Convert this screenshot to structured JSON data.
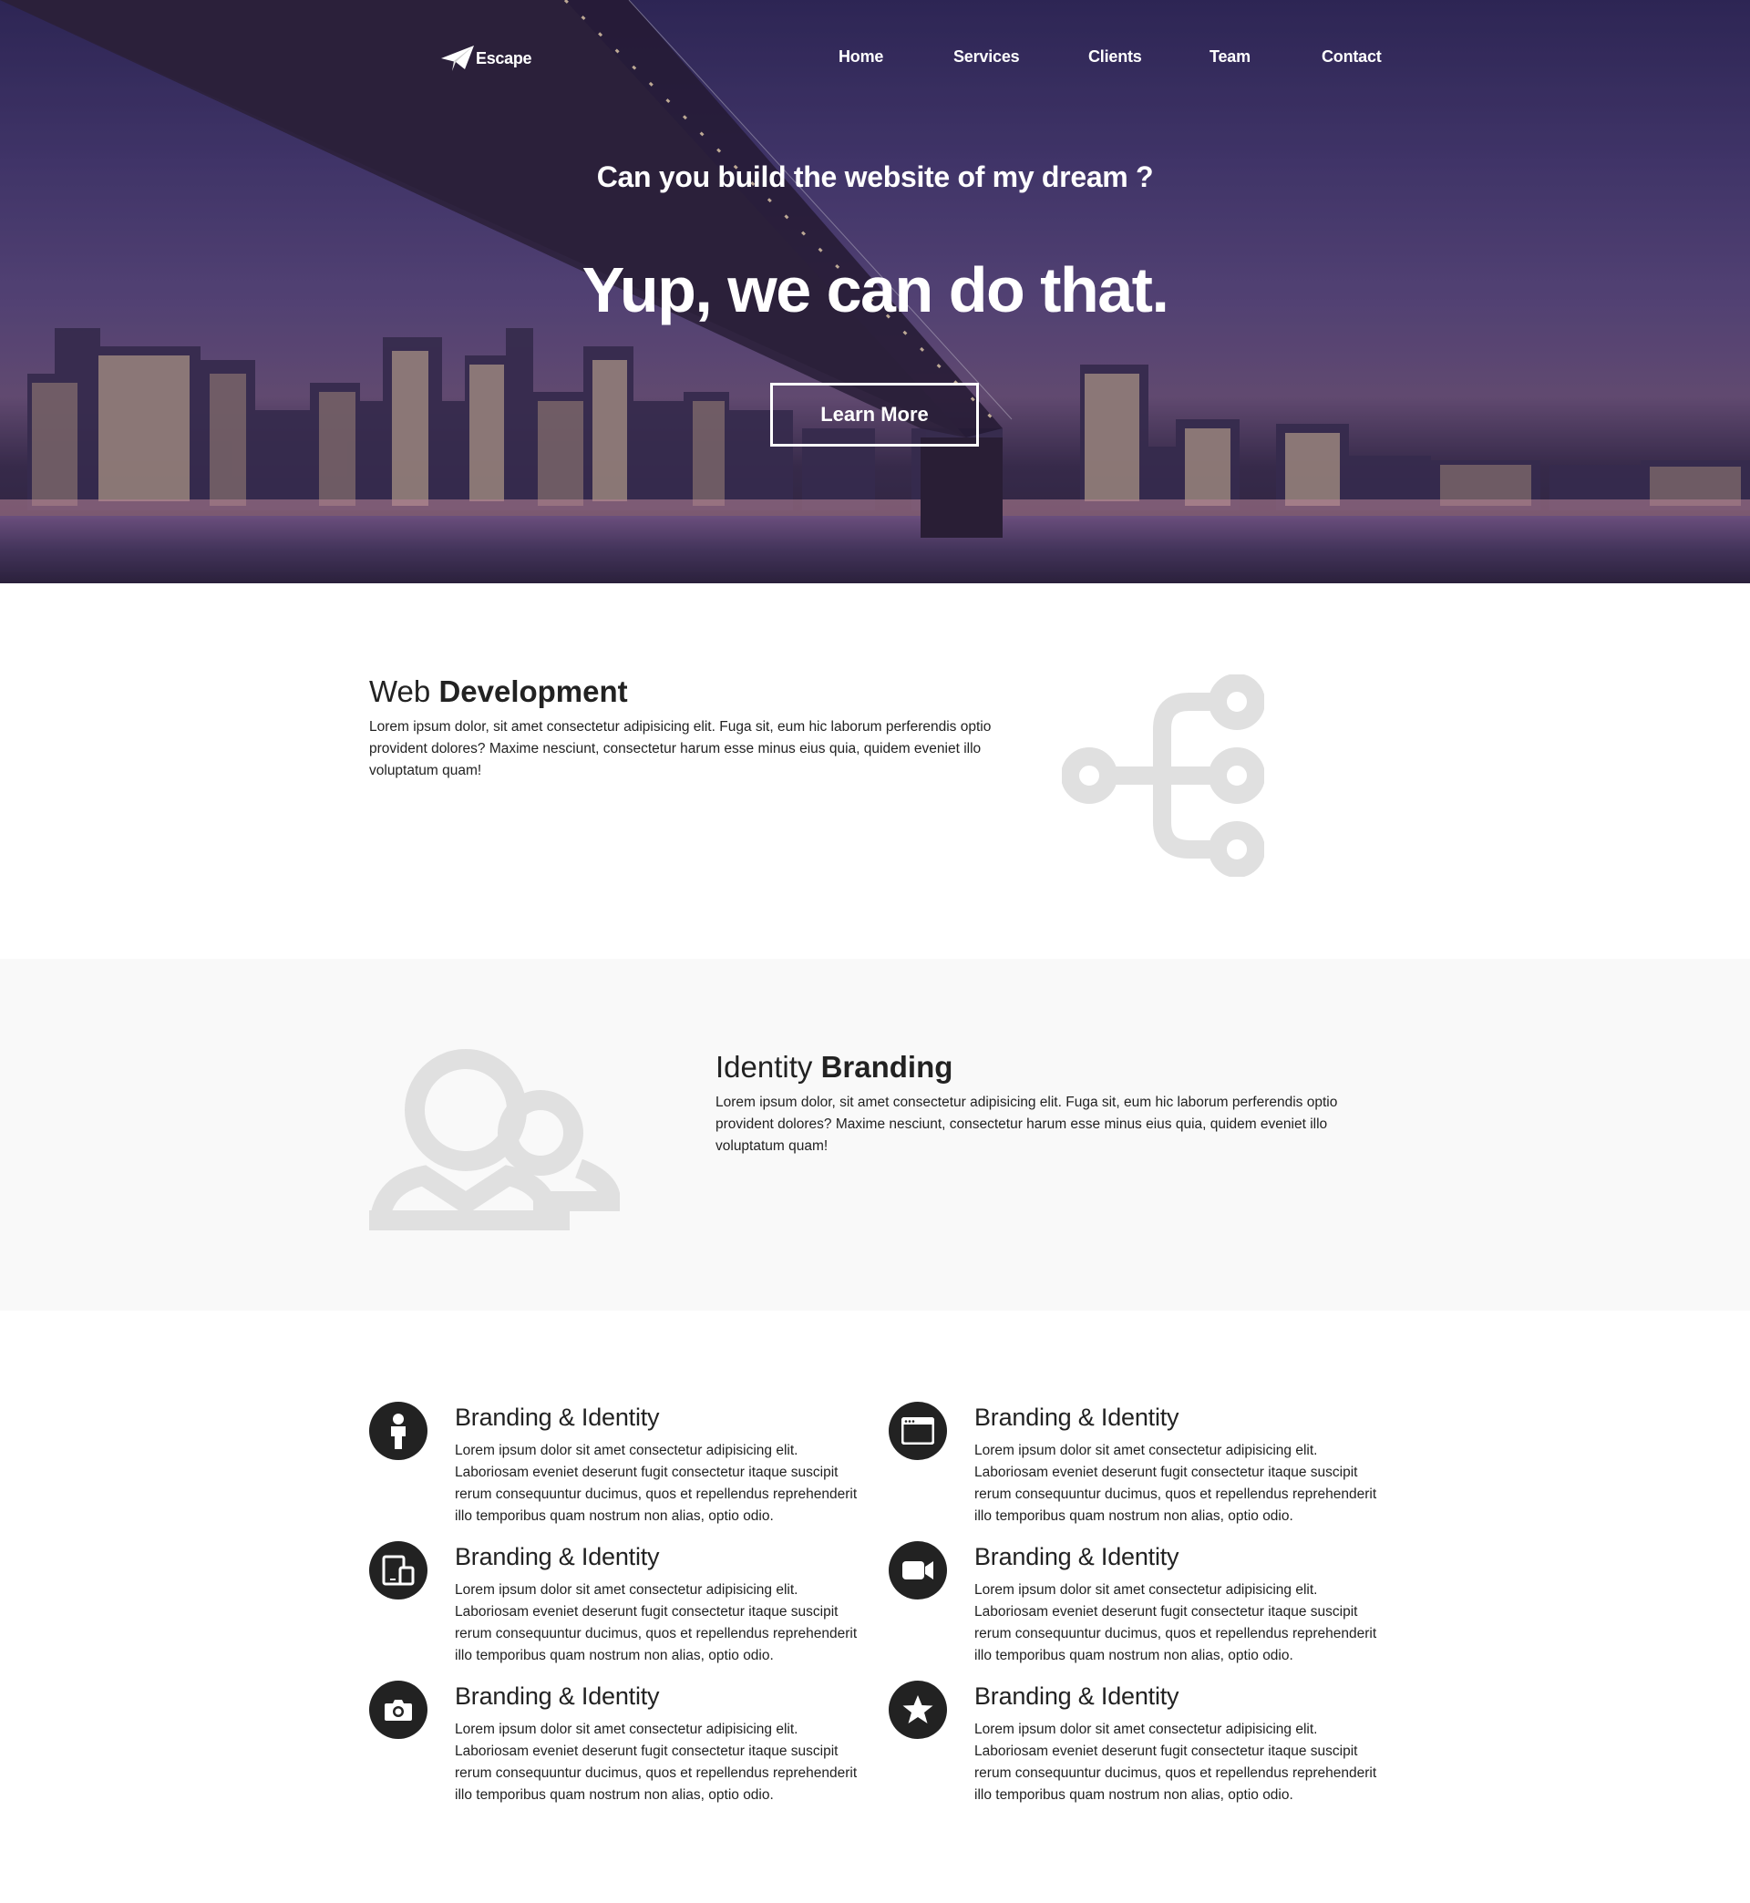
{
  "nav": {
    "logo_text": "Escape",
    "links": [
      "Home",
      "Services",
      "Clients",
      "Team",
      "Contact"
    ]
  },
  "hero": {
    "subtitle": "Can you build the website of my dream ?",
    "title": "Yup, we can do that.",
    "cta_label": "Learn More"
  },
  "features": [
    {
      "title_light": "Web ",
      "title_bold": "Development",
      "text": "Lorem ipsum dolor, sit amet consectetur adipisicing elit. Fuga sit, eum hic laborum perferendis optio provident dolores? Maxime nesciunt, consectetur harum esse minus eius quia, quidem eveniet illo voluptatum quam!",
      "icon": "sitemap-icon"
    },
    {
      "title_light": "Identity ",
      "title_bold": "Branding",
      "text": "Lorem ipsum dolor, sit amet consectetur adipisicing elit. Fuga sit, eum hic laborum perferendis optio provident dolores? Maxime nesciunt, consectetur harum esse minus eius quia, quidem eveniet illo voluptatum quam!",
      "icon": "users-icon"
    }
  ],
  "services": [
    {
      "title": "Branding & Identity",
      "text": "Lorem ipsum dolor sit amet consectetur adipisicing elit. Laboriosam eveniet deserunt fugit consectetur itaque suscipit rerum consequuntur ducimus, quos et repellendus reprehenderit illo temporibus quam nostrum non alias, optio odio.",
      "icon": "person-icon"
    },
    {
      "title": "Branding & Identity",
      "text": "Lorem ipsum dolor sit amet consectetur adipisicing elit. Laboriosam eveniet deserunt fugit consectetur itaque suscipit rerum consequuntur ducimus, quos et repellendus reprehenderit illo temporibus quam nostrum non alias, optio odio.",
      "icon": "browser-window-icon"
    },
    {
      "title": "Branding & Identity",
      "text": "Lorem ipsum dolor sit amet consectetur adipisicing elit. Laboriosam eveniet deserunt fugit consectetur itaque suscipit rerum consequuntur ducimus, quos et repellendus reprehenderit illo temporibus quam nostrum non alias, optio odio.",
      "icon": "devices-icon"
    },
    {
      "title": "Branding & Identity",
      "text": "Lorem ipsum dolor sit amet consectetur adipisicing elit. Laboriosam eveniet deserunt fugit consectetur itaque suscipit rerum consequuntur ducimus, quos et repellendus reprehenderit illo temporibus quam nostrum non alias, optio odio.",
      "icon": "video-camera-icon"
    },
    {
      "title": "Branding & Identity",
      "text": "Lorem ipsum dolor sit amet consectetur adipisicing elit. Laboriosam eveniet deserunt fugit consectetur itaque suscipit rerum consequuntur ducimus, quos et repellendus reprehenderit illo temporibus quam nostrum non alias, optio odio.",
      "icon": "camera-icon"
    },
    {
      "title": "Branding & Identity",
      "text": "Lorem ipsum dolor sit amet consectetur adipisicing elit. Laboriosam eveniet deserunt fugit consectetur itaque suscipit rerum consequuntur ducimus, quos et repellendus reprehenderit illo temporibus quam nostrum non alias, optio odio.",
      "icon": "star-icon"
    }
  ],
  "colors": {
    "dark": "#222222",
    "light_icon": "#e0e0e0",
    "section_gray": "#f9f9f9",
    "hero_purple": "#463a6e"
  }
}
